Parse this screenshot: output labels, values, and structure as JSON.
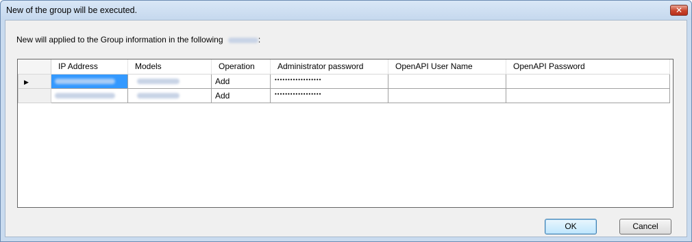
{
  "window": {
    "title": "New of the group will be executed.",
    "close_glyph": "✕"
  },
  "message": {
    "before": "New will applied to the Group information in the following",
    "after": ":"
  },
  "grid": {
    "columns": [
      "IP Address",
      "Models",
      "Operation",
      "Administrator password",
      "OpenAPI User Name",
      "OpenAPI Password"
    ],
    "rows": [
      {
        "current": true,
        "operation": "Add",
        "admin_password": "••••••••••••••••••",
        "openapi_user": "",
        "openapi_password": ""
      },
      {
        "current": false,
        "operation": "Add",
        "admin_password": "••••••••••••••••••",
        "openapi_user": "",
        "openapi_password": ""
      }
    ],
    "row_indicator_glyph": "▶"
  },
  "buttons": {
    "ok": "OK",
    "cancel": "Cancel"
  },
  "colors": {
    "selection": "#3399ff",
    "close_button": "#c9442b",
    "dialog_bg": "#f0f0f0"
  },
  "icons": {
    "close": "close-icon",
    "row_indicator": "current-row-arrow-icon"
  }
}
